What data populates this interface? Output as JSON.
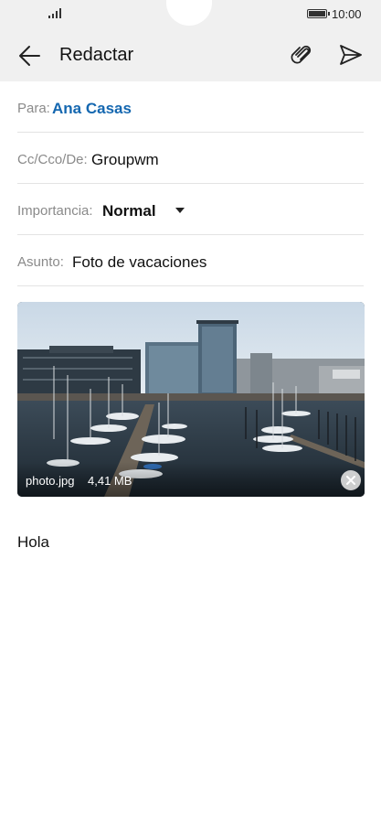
{
  "status_bar": {
    "time": "10:00",
    "icons": [
      "signal-icon",
      "battery-icon"
    ]
  },
  "app_bar": {
    "title": "Redactar",
    "icons": [
      "back-arrow-icon",
      "paperclip-icon",
      "send-icon"
    ]
  },
  "fields": {
    "to": {
      "label": "Para:",
      "value": "Ana Casas"
    },
    "cc": {
      "label": "Cc/Cco/De:",
      "value": "Groupwm"
    },
    "importance": {
      "label": "Importancia:",
      "value": "Normal"
    },
    "subject": {
      "label": "Asunto:",
      "value": "Foto de vacaciones"
    }
  },
  "attachment": {
    "name": "photo.jpg",
    "size": "4,41 MB",
    "remove_icon": "close-icon"
  },
  "message_body": "Hola",
  "colors": {
    "bar_background": "#f0f0f0",
    "recipient_blue": "#1467b0",
    "divider": "#e3e3e3"
  }
}
